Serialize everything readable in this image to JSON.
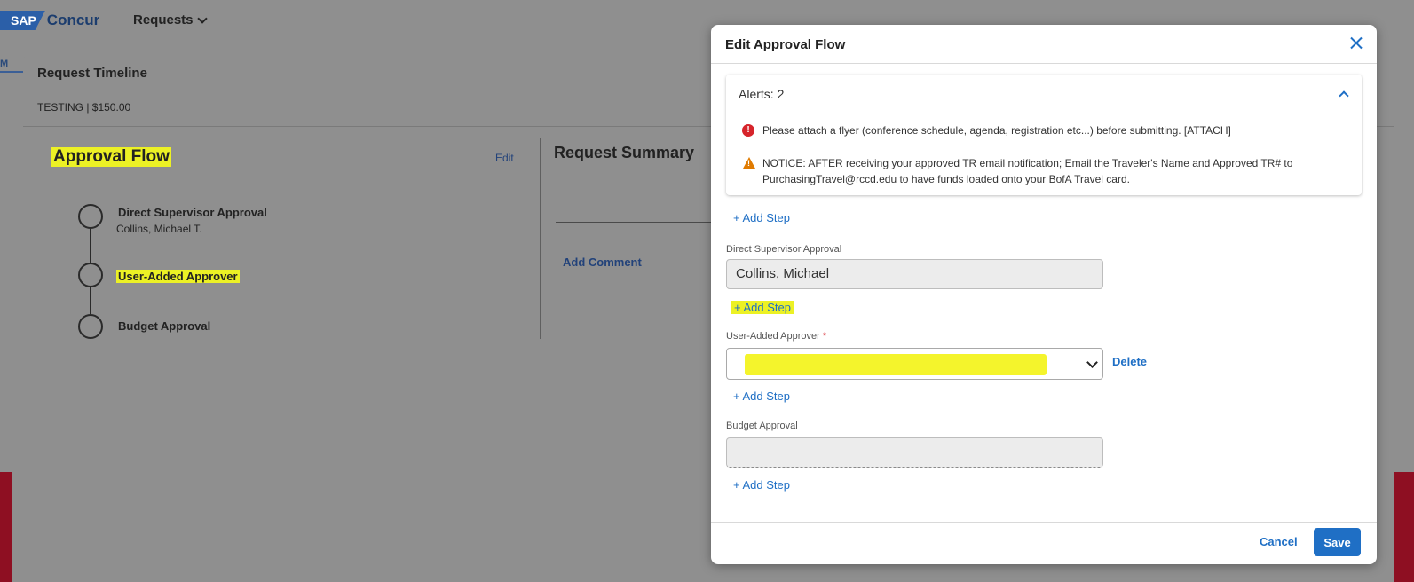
{
  "header": {
    "logo_sap": "SAP",
    "logo_concur": "Concur",
    "nav_requests": "Requests"
  },
  "edge_tab_letter": "M",
  "timeline": {
    "title": "Request Timeline",
    "subtitle": "TESTING | $150.00",
    "approval_flow_title": "Approval Flow",
    "edit_link": "Edit",
    "request_summary_title": "Request Summary",
    "add_comment": "Add Comment",
    "steps": [
      {
        "title": "Direct Supervisor Approval",
        "approver": "Collins, Michael T."
      },
      {
        "title": "User-Added Approver",
        "approver": ""
      },
      {
        "title": "Budget Approval",
        "approver": ""
      }
    ]
  },
  "modal": {
    "title": "Edit Approval Flow",
    "alerts_label": "Alerts: 2",
    "alerts": [
      {
        "type": "error",
        "text": "Please attach a flyer (conference schedule, agenda, registration etc...) before submitting. [ATTACH]"
      },
      {
        "type": "warning",
        "text": "NOTICE: AFTER receiving your approved TR email notification; Email the Traveler's Name and Approved TR# to PurchasingTravel@rccd.edu to have funds loaded onto your BofA Travel card."
      }
    ],
    "add_step": "+ Add Step",
    "fields": [
      {
        "label": "Direct Supervisor Approval",
        "value": "Collins, Michael",
        "required": false
      },
      {
        "label": "User-Added Approver",
        "value": "",
        "required": true
      },
      {
        "label": "Budget Approval",
        "value": "",
        "required": false
      }
    ],
    "required_marker": "*",
    "delete_link": "Delete",
    "cancel_label": "Cancel",
    "save_label": "Save"
  },
  "colors": {
    "accent": "#1f6fc5",
    "highlight": "#ecf125",
    "error": "#d6242b",
    "warning": "#e07b00",
    "brand_red": "#8e0f22"
  }
}
